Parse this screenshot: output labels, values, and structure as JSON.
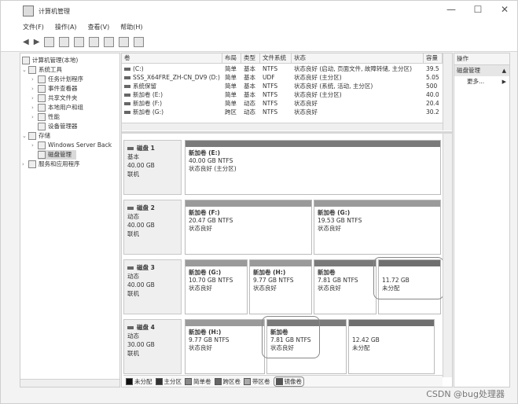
{
  "window": {
    "title": "计算机管理",
    "controls": [
      "—",
      "☐",
      "✕"
    ]
  },
  "menu": [
    "文件(F)",
    "操作(A)",
    "查看(V)",
    "帮助(H)"
  ],
  "tree": [
    {
      "label": "计算机管理(本地)",
      "level": 0
    },
    {
      "label": "系统工具",
      "level": 1
    },
    {
      "label": "任务计划程序",
      "level": 2
    },
    {
      "label": "事件查看器",
      "level": 2
    },
    {
      "label": "共享文件夹",
      "level": 2
    },
    {
      "label": "本地用户和组",
      "level": 2
    },
    {
      "label": "性能",
      "level": 2
    },
    {
      "label": "设备管理器",
      "level": 2
    },
    {
      "label": "存储",
      "level": 1
    },
    {
      "label": "Windows Server Back",
      "level": 2
    },
    {
      "label": "磁盘管理",
      "level": 2
    },
    {
      "label": "服务和应用程序",
      "level": 1
    }
  ],
  "volume_table": {
    "columns": [
      "卷",
      "布局",
      "类型",
      "文件系统",
      "状态",
      "容量"
    ],
    "rows": [
      [
        "(C:)",
        "简单",
        "基本",
        "NTFS",
        "状态良好 (启动, 页面文件, 故障转储, 主分区)",
        "39.5"
      ],
      [
        "SSS_X64FRE_ZH-CN_DV9 (D:)",
        "简单",
        "基本",
        "UDF",
        "状态良好 (主分区)",
        "5.05"
      ],
      [
        "系统保留",
        "简单",
        "基本",
        "NTFS",
        "状态良好 (系统, 活动, 主分区)",
        "500"
      ],
      [
        "新加卷 (E:)",
        "简单",
        "基本",
        "NTFS",
        "状态良好 (主分区)",
        "40.0"
      ],
      [
        "新加卷 (F:)",
        "简单",
        "动态",
        "NTFS",
        "状态良好",
        "20.4"
      ],
      [
        "新加卷 (G:)",
        "跨区",
        "动态",
        "NTFS",
        "状态良好",
        "30.2"
      ]
    ]
  },
  "disks": [
    {
      "name": "磁盘 1",
      "kind": "基本",
      "size": "40.00 GB",
      "status": "联机",
      "partitions": [
        {
          "name": "新加卷 (E:)",
          "size": "40.00 GB NTFS",
          "status": "状态良好 (主分区)"
        }
      ]
    },
    {
      "name": "磁盘 2",
      "kind": "动态",
      "size": "40.00 GB",
      "status": "联机",
      "partitions": [
        {
          "name": "新加卷 (F:)",
          "size": "20.47 GB NTFS",
          "status": "状态良好"
        },
        {
          "name": "新加卷 (G:)",
          "size": "19.53 GB NTFS",
          "status": "状态良好"
        }
      ]
    },
    {
      "name": "磁盘 3",
      "kind": "动态",
      "size": "40.00 GB",
      "status": "联机",
      "partitions": [
        {
          "name": "新加卷 (G:)",
          "size": "10.70 GB NTFS",
          "status": "状态良好"
        },
        {
          "name": "新加卷 (H:)",
          "size": "9.77 GB NTFS",
          "status": "状态良好"
        },
        {
          "name": "新加卷",
          "size": "7.81 GB NTFS",
          "status": "状态良好"
        },
        {
          "name": "",
          "size": "11.72 GB",
          "status": "未分配"
        }
      ]
    },
    {
      "name": "磁盘 4",
      "kind": "动态",
      "size": "30.00 GB",
      "status": "联机",
      "partitions": [
        {
          "name": "新加卷 (H:)",
          "size": "9.77 GB NTFS",
          "status": "状态良好"
        },
        {
          "name": "新加卷",
          "size": "7.81 GB NTFS",
          "status": "状态良好"
        },
        {
          "name": "",
          "size": "12.42 GB",
          "status": "未分配"
        }
      ]
    }
  ],
  "legend": [
    "未分配",
    "主分区",
    "简单卷",
    "跨区卷",
    "带区卷",
    "镜像卷"
  ],
  "actions": {
    "header": "操作",
    "section": "磁盘管理",
    "more": "更多..."
  },
  "watermark": "CSDN @bug处理器"
}
